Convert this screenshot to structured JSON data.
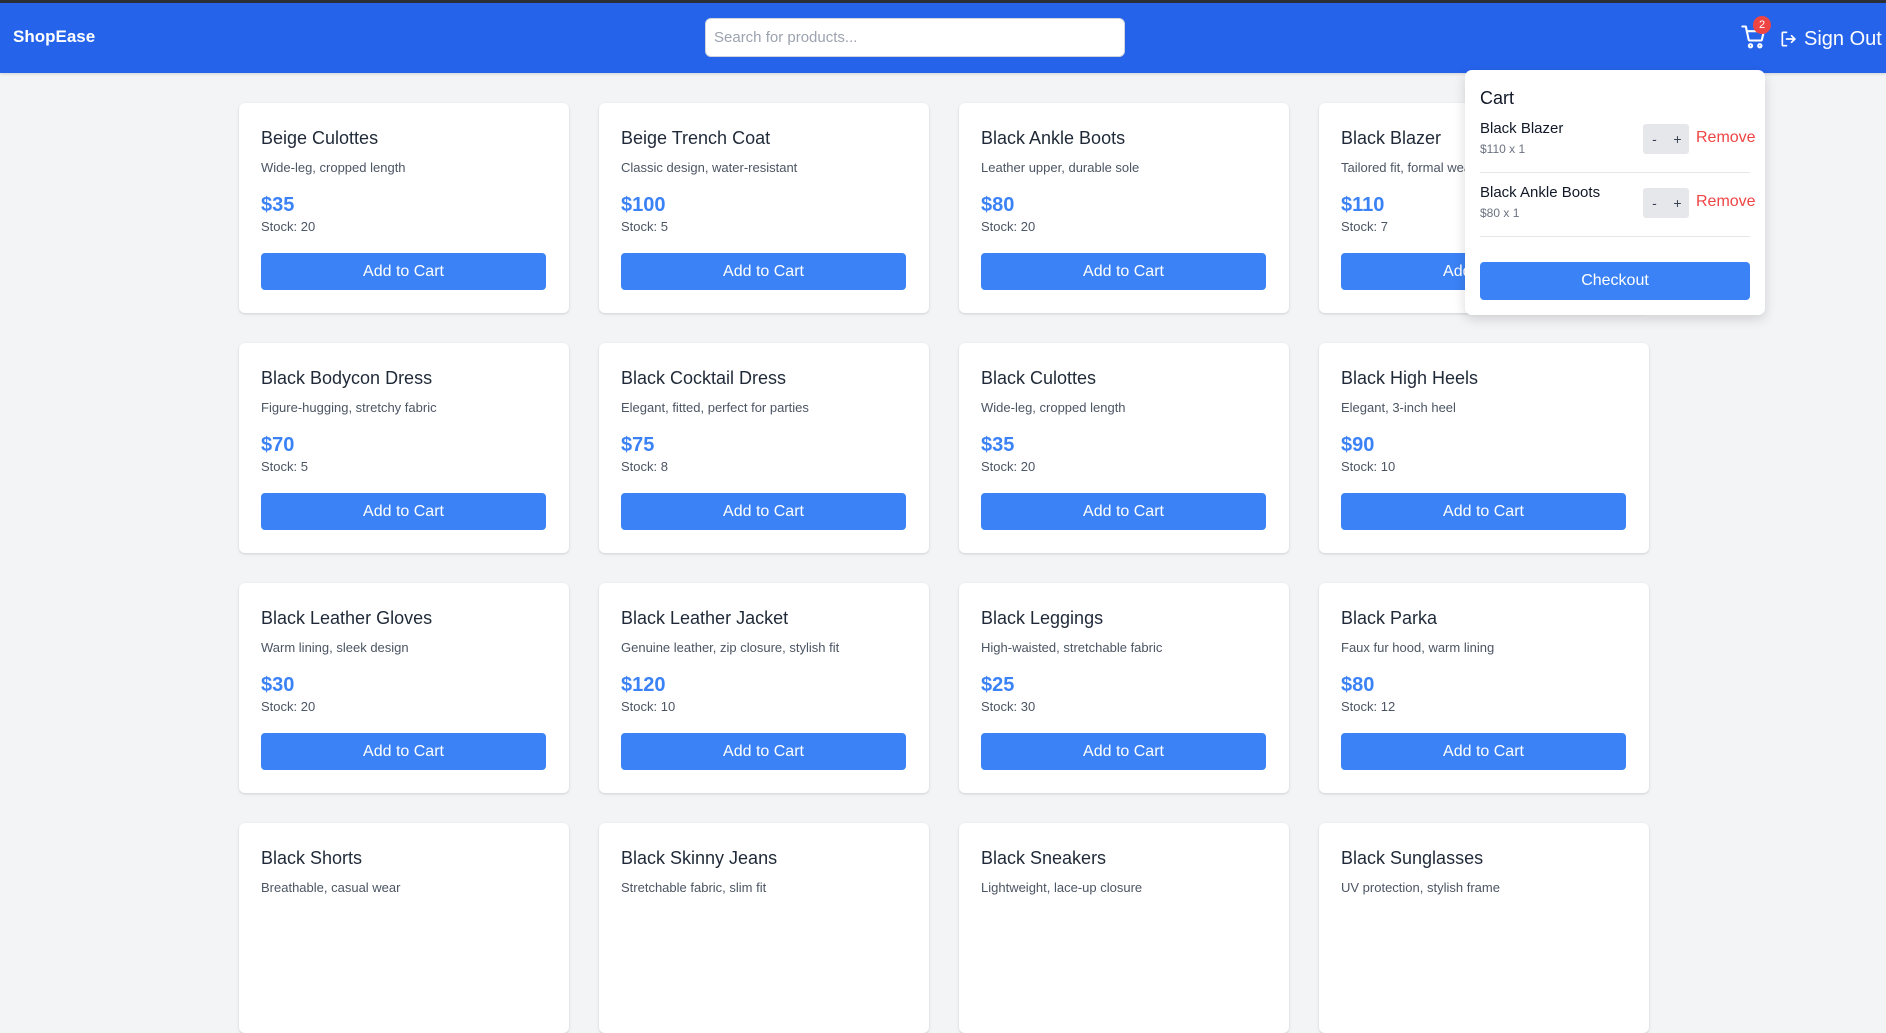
{
  "header": {
    "brand": "ShopEase",
    "search_placeholder": "Search for products...",
    "cart_count": "2",
    "signout_label": "Sign Out",
    "bg_color": "#2563eb"
  },
  "products": [
    {
      "name": "Beige Culottes",
      "desc": "Wide-leg, cropped length",
      "price": "$35",
      "stock": "Stock: 20",
      "button": "Add to Cart"
    },
    {
      "name": "Beige Trench Coat",
      "desc": "Classic design, water-resistant",
      "price": "$100",
      "stock": "Stock: 5",
      "button": "Add to Cart"
    },
    {
      "name": "Black Ankle Boots",
      "desc": "Leather upper, durable sole",
      "price": "$80",
      "stock": "Stock: 20",
      "button": "Add to Cart"
    },
    {
      "name": "Black Blazer",
      "desc": "Tailored fit, formal wear",
      "price": "$110",
      "stock": "Stock: 7",
      "button": "Add to Cart"
    },
    {
      "name": "Black Bodycon Dress",
      "desc": "Figure-hugging, stretchy fabric",
      "price": "$70",
      "stock": "Stock: 5",
      "button": "Add to Cart"
    },
    {
      "name": "Black Cocktail Dress",
      "desc": "Elegant, fitted, perfect for parties",
      "price": "$75",
      "stock": "Stock: 8",
      "button": "Add to Cart"
    },
    {
      "name": "Black Culottes",
      "desc": "Wide-leg, cropped length",
      "price": "$35",
      "stock": "Stock: 20",
      "button": "Add to Cart"
    },
    {
      "name": "Black High Heels",
      "desc": "Elegant, 3-inch heel",
      "price": "$90",
      "stock": "Stock: 10",
      "button": "Add to Cart"
    },
    {
      "name": "Black Leather Gloves",
      "desc": "Warm lining, sleek design",
      "price": "$30",
      "stock": "Stock: 20",
      "button": "Add to Cart"
    },
    {
      "name": "Black Leather Jacket",
      "desc": "Genuine leather, zip closure, stylish fit",
      "price": "$120",
      "stock": "Stock: 10",
      "button": "Add to Cart"
    },
    {
      "name": "Black Leggings",
      "desc": "High-waisted, stretchable fabric",
      "price": "$25",
      "stock": "Stock: 30",
      "button": "Add to Cart"
    },
    {
      "name": "Black Parka",
      "desc": "Faux fur hood, warm lining",
      "price": "$80",
      "stock": "Stock: 12",
      "button": "Add to Cart"
    },
    {
      "name": "Black Shorts",
      "desc": "Breathable, casual wear",
      "price": "",
      "stock": "",
      "button": ""
    },
    {
      "name": "Black Skinny Jeans",
      "desc": "Stretchable fabric, slim fit",
      "price": "",
      "stock": "",
      "button": ""
    },
    {
      "name": "Black Sneakers",
      "desc": "Lightweight, lace-up closure",
      "price": "",
      "stock": "",
      "button": ""
    },
    {
      "name": "Black Sunglasses",
      "desc": "UV protection, stylish frame",
      "price": "",
      "stock": "",
      "button": ""
    }
  ],
  "cart": {
    "title": "Cart",
    "items": [
      {
        "name": "Black Blazer",
        "price_qty": "$110 x 1",
        "minus": "-",
        "plus": "+",
        "remove": "Remove"
      },
      {
        "name": "Black Ankle Boots",
        "price_qty": "$80 x 1",
        "minus": "-",
        "plus": "+",
        "remove": "Remove"
      }
    ],
    "checkout_label": "Checkout"
  }
}
